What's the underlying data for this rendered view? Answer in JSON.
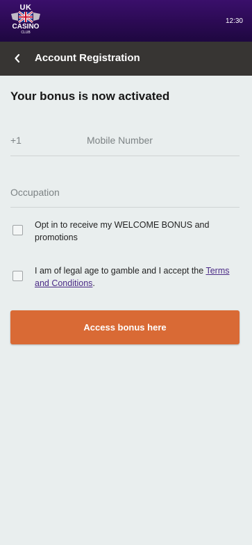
{
  "status_bar": {
    "time": "12:30",
    "logo": {
      "line1": "UK",
      "line2": "CASINO",
      "line3": "CLUB"
    }
  },
  "header": {
    "back_icon": "chevron-left-icon",
    "title": "Account Registration"
  },
  "form": {
    "heading": "Your bonus is now activated",
    "phone": {
      "prefix": "+1",
      "placeholder": "Mobile Number"
    },
    "occupation": {
      "placeholder": "Occupation"
    },
    "checkboxes": [
      {
        "label": "Opt in to receive my WELCOME BONUS and promotions",
        "checked": false
      },
      {
        "label_prefix": "I am of legal age to gamble and I accept the ",
        "link_text": "Terms and Conditions",
        "label_suffix": ".",
        "checked": false
      }
    ],
    "submit_label": "Access bonus here"
  },
  "colors": {
    "status_bar": "#2b0a53",
    "header_bar": "#373533",
    "background": "#e9eeee",
    "cta": "#d96a35",
    "link": "#4a2a86"
  }
}
